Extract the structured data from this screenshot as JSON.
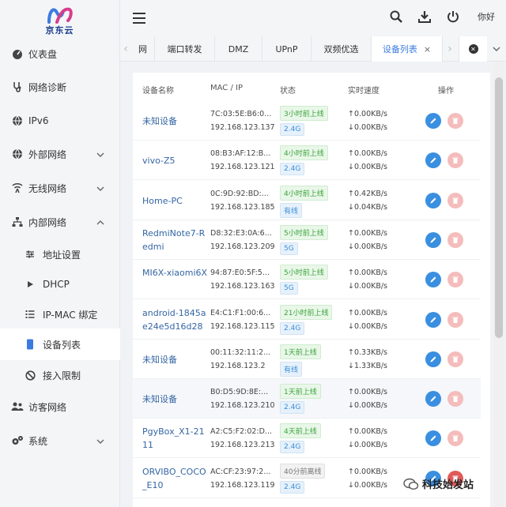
{
  "brand": {
    "name": "京东云"
  },
  "topbar": {
    "greeting": "你好"
  },
  "sidebar": {
    "items": [
      {
        "label": "仪表盘",
        "icon": "dashboard-icon"
      },
      {
        "label": "网络诊断",
        "icon": "stethoscope-icon"
      },
      {
        "label": "IPv6",
        "icon": "globe-icon"
      },
      {
        "label": "外部网络",
        "icon": "globe-icon"
      },
      {
        "label": "无线网络",
        "icon": "wifi-icon"
      },
      {
        "label": "内部网络",
        "icon": "network-icon"
      },
      {
        "label": "地址设置",
        "icon": "sliders-icon"
      },
      {
        "label": "DHCP",
        "icon": "play-icon"
      },
      {
        "label": "IP-MAC 绑定",
        "icon": "list-icon"
      },
      {
        "label": "设备列表",
        "icon": "device-icon"
      },
      {
        "label": "接入限制",
        "icon": "ban-icon"
      },
      {
        "label": "访客网络",
        "icon": "users-icon"
      },
      {
        "label": "系统",
        "icon": "gears-icon"
      }
    ]
  },
  "tabs": [
    {
      "label": "网"
    },
    {
      "label": "端口转发"
    },
    {
      "label": "DMZ"
    },
    {
      "label": "UPnP"
    },
    {
      "label": "双频优选"
    },
    {
      "label": "设备列表",
      "close": "×"
    }
  ],
  "table": {
    "headers": [
      "设备名称",
      "MAC / IP",
      "状态",
      "实时速度",
      "操作"
    ],
    "rows": [
      {
        "name": "未知设备",
        "mac": "7C:03:5E:B6:0...",
        "ip": "192.168.123.137",
        "status": "3小时前上线",
        "band": "2.4G",
        "up": "↑0.00KB/s",
        "down": "↓0.00KB/s"
      },
      {
        "name": "vivo-Z5",
        "mac": "08:B3:AF:12:B...",
        "ip": "192.168.123.121",
        "status": "4小时前上线",
        "band": "2.4G",
        "up": "↑0.00KB/s",
        "down": "↓0.00KB/s"
      },
      {
        "name": "Home-PC",
        "mac": "0C:9D:92:BD:...",
        "ip": "192.168.123.185",
        "status": "4小时前上线",
        "band": "有线",
        "up": "↑0.42KB/s",
        "down": "↓0.04KB/s"
      },
      {
        "name": "RedmiNote7-Redmi",
        "mac": "D8:32:E3:0A:6...",
        "ip": "192.168.123.209",
        "status": "5小时前上线",
        "band": "5G",
        "up": "↑0.00KB/s",
        "down": "↓0.00KB/s"
      },
      {
        "name": "MI6X-xiaomi6X",
        "mac": "94:87:E0:5F:5...",
        "ip": "192.168.123.163",
        "status": "5小时前上线",
        "band": "5G",
        "up": "↑0.00KB/s",
        "down": "↓0.00KB/s"
      },
      {
        "name": "android-1845ae24e5d16d28",
        "mac": "E4:C1:F1:00:6...",
        "ip": "192.168.123.115",
        "status": "21小时前上线",
        "band": "2.4G",
        "up": "↑0.00KB/s",
        "down": "↓0.00KB/s"
      },
      {
        "name": "未知设备",
        "mac": "00:11:32:11:2...",
        "ip": "192.168.123.2",
        "status": "1天前上线",
        "band": "有线",
        "up": "↑0.33KB/s",
        "down": "↓1.33KB/s"
      },
      {
        "name": "未知设备",
        "mac": "B0:D5:9D:8E:...",
        "ip": "192.168.123.210",
        "status": "1天前上线",
        "band": "2.4G",
        "up": "↑0.00KB/s",
        "down": "↓0.00KB/s"
      },
      {
        "name": "PgyBox_X1-2111",
        "mac": "A2:C5:F2:02:D...",
        "ip": "192.168.123.213",
        "status": "4天前上线",
        "band": "2.4G",
        "up": "↑0.00KB/s",
        "down": "↓0.00KB/s"
      },
      {
        "name": "ORVIBO_COCO_E10",
        "mac": "AC:CF:23:97:2...",
        "ip": "192.168.123.119",
        "status": "40分前离线",
        "band": "2.4G",
        "up": "↑0.00KB/s",
        "down": "↓0.00KB/s"
      }
    ]
  },
  "watermark": {
    "text": "科技始发站"
  },
  "colors": {
    "accent": "#3a8fe0",
    "link": "#3465a4",
    "online": "#3ba43b",
    "delete": "#f5bcbc"
  }
}
